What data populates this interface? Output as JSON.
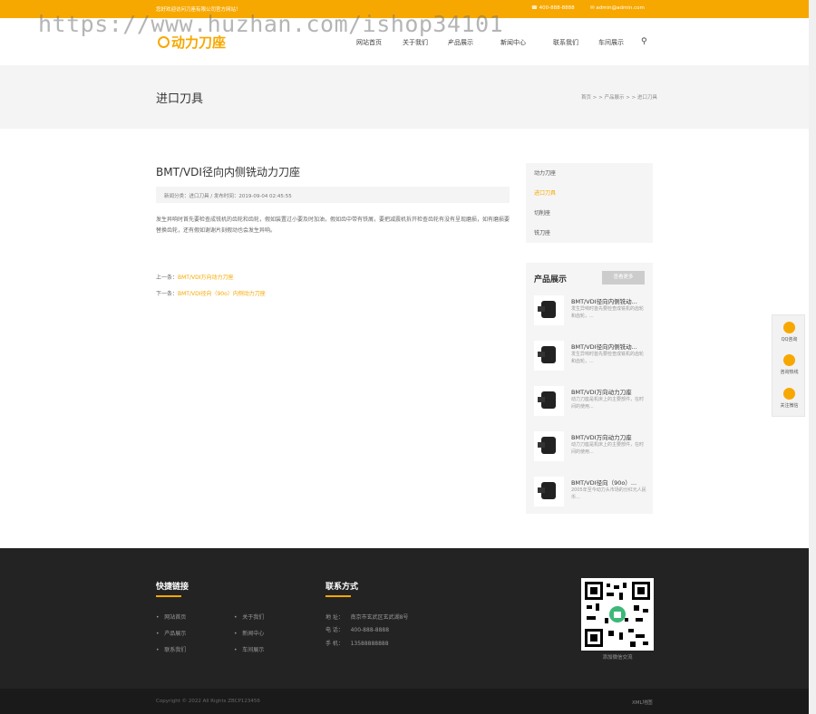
{
  "topbar": {
    "welcome": "您好欢迎访问刀座有限公司官方网站！",
    "phone": "400-888-8888",
    "email": "admin@admin.com"
  },
  "watermark": "https://www.huzhan.com/ishop34101",
  "logo": {
    "text": "动力刀座"
  },
  "nav": [
    "网站首页",
    "关于我们",
    "产品展示",
    "新闻中心",
    "联系我们",
    "车间展示"
  ],
  "banner": {
    "title": "进口刀具",
    "breadcrumb": "首页 > > 产品展示 > > 进口刀具"
  },
  "article": {
    "title": "BMT/VDI径向内侧铣动力刀座",
    "meta": "新闻分类：进口刀具    /    发布时间：2019-09-04 02:45:55",
    "body": "发生异响时首先要检查成铣机的齿轮和齿轮，假如装置过小要及时加油，假如齿中带有铁屑，要把减震机拆开检查齿轮有没有呈现磨损，如有磨损要替换齿轮，还有假如谢谢片刻假动也会发生异响。",
    "prev_label": "上一条：",
    "prev_link": "BMT/VDI万向动力刀座",
    "next_label": "下一条：",
    "next_link": "BMT/VDI径向（90o）内侧动力刀座"
  },
  "categories": [
    "动力刀座",
    "进口刀具",
    "切削座",
    "铣刀座"
  ],
  "products": {
    "head": "产品展示",
    "more": "查看更多",
    "items": [
      {
        "title": "BMT/VDI径向内侧铣动...",
        "desc": "发生异响时首先要检查成铣机的齿轮和齿轮，..."
      },
      {
        "title": "BMT/VDI径向内侧铣动...",
        "desc": "发生异响时首先要检查成铣机的齿轮和齿轮，..."
      },
      {
        "title": "BMT/VDI万向动力刀座",
        "desc": "动力刀座是机床上的主要部件，在时间的使用..."
      },
      {
        "title": "BMT/VDI万向动力刀座",
        "desc": "动力刀座是机床上的主要部件，在时间的使用..."
      },
      {
        "title": "BMT/VDI径向（90o）...",
        "desc": "2005年至今动力头市场的分红元人民币..."
      }
    ]
  },
  "side_float": [
    "QQ咨询",
    "咨询热线",
    "关注微信"
  ],
  "footer": {
    "quick_title": "快捷链接",
    "quick_links": [
      "网站首页",
      "关于我们",
      "产品展示",
      "新闻中心",
      "联系我们",
      "车间展示"
    ],
    "contact_title": "联系方式",
    "contact": [
      {
        "label": "地 址：",
        "value": "南京市玄武区玄武湖8号"
      },
      {
        "label": "电 话：",
        "value": "400-888-8888"
      },
      {
        "label": "手 机：",
        "value": "13588888888"
      }
    ],
    "qr_caption": "添加微信交流",
    "copyright": "Copyright © 2022 All Rights ZBCP123456",
    "sitemap": "XML地图"
  },
  "colors": {
    "accent": "#f7a800",
    "footer": "#232323"
  }
}
